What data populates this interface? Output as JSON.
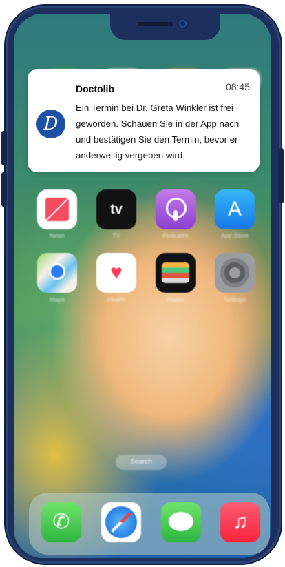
{
  "notification": {
    "app_name": "Doctolib",
    "time": "08:45",
    "logo_letter": "D",
    "message": "Ein Termin bei Dr. Greta Winkler ist frei geworden. Schauen Sie in der App nach und bestätigen Sie den Termin, bevor er anderweitig vergeben wird."
  },
  "apps": {
    "row1": [
      {
        "label": "News",
        "icon": "news-icon"
      },
      {
        "label": "TV",
        "icon": "apple-tv-icon"
      },
      {
        "label": "Podcasts",
        "icon": "podcasts-icon"
      },
      {
        "label": "App Store",
        "icon": "app-store-icon"
      }
    ],
    "row2": [
      {
        "label": "Maps",
        "icon": "maps-icon"
      },
      {
        "label": "Health",
        "icon": "health-icon"
      },
      {
        "label": "Wallet",
        "icon": "wallet-icon"
      },
      {
        "label": "Settings",
        "icon": "settings-icon"
      }
    ]
  },
  "glyphs": {
    "tv": "tv",
    "app_store": "A",
    "health": "♥",
    "phone": "✆",
    "music": "♫"
  },
  "search": {
    "label": "Search"
  },
  "dock": [
    {
      "icon": "phone-icon"
    },
    {
      "icon": "safari-icon"
    },
    {
      "icon": "messages-icon"
    },
    {
      "icon": "music-icon"
    }
  ],
  "colors": {
    "frame": "#1d2f5c",
    "doctolib_blue": "#1c4fa6"
  }
}
